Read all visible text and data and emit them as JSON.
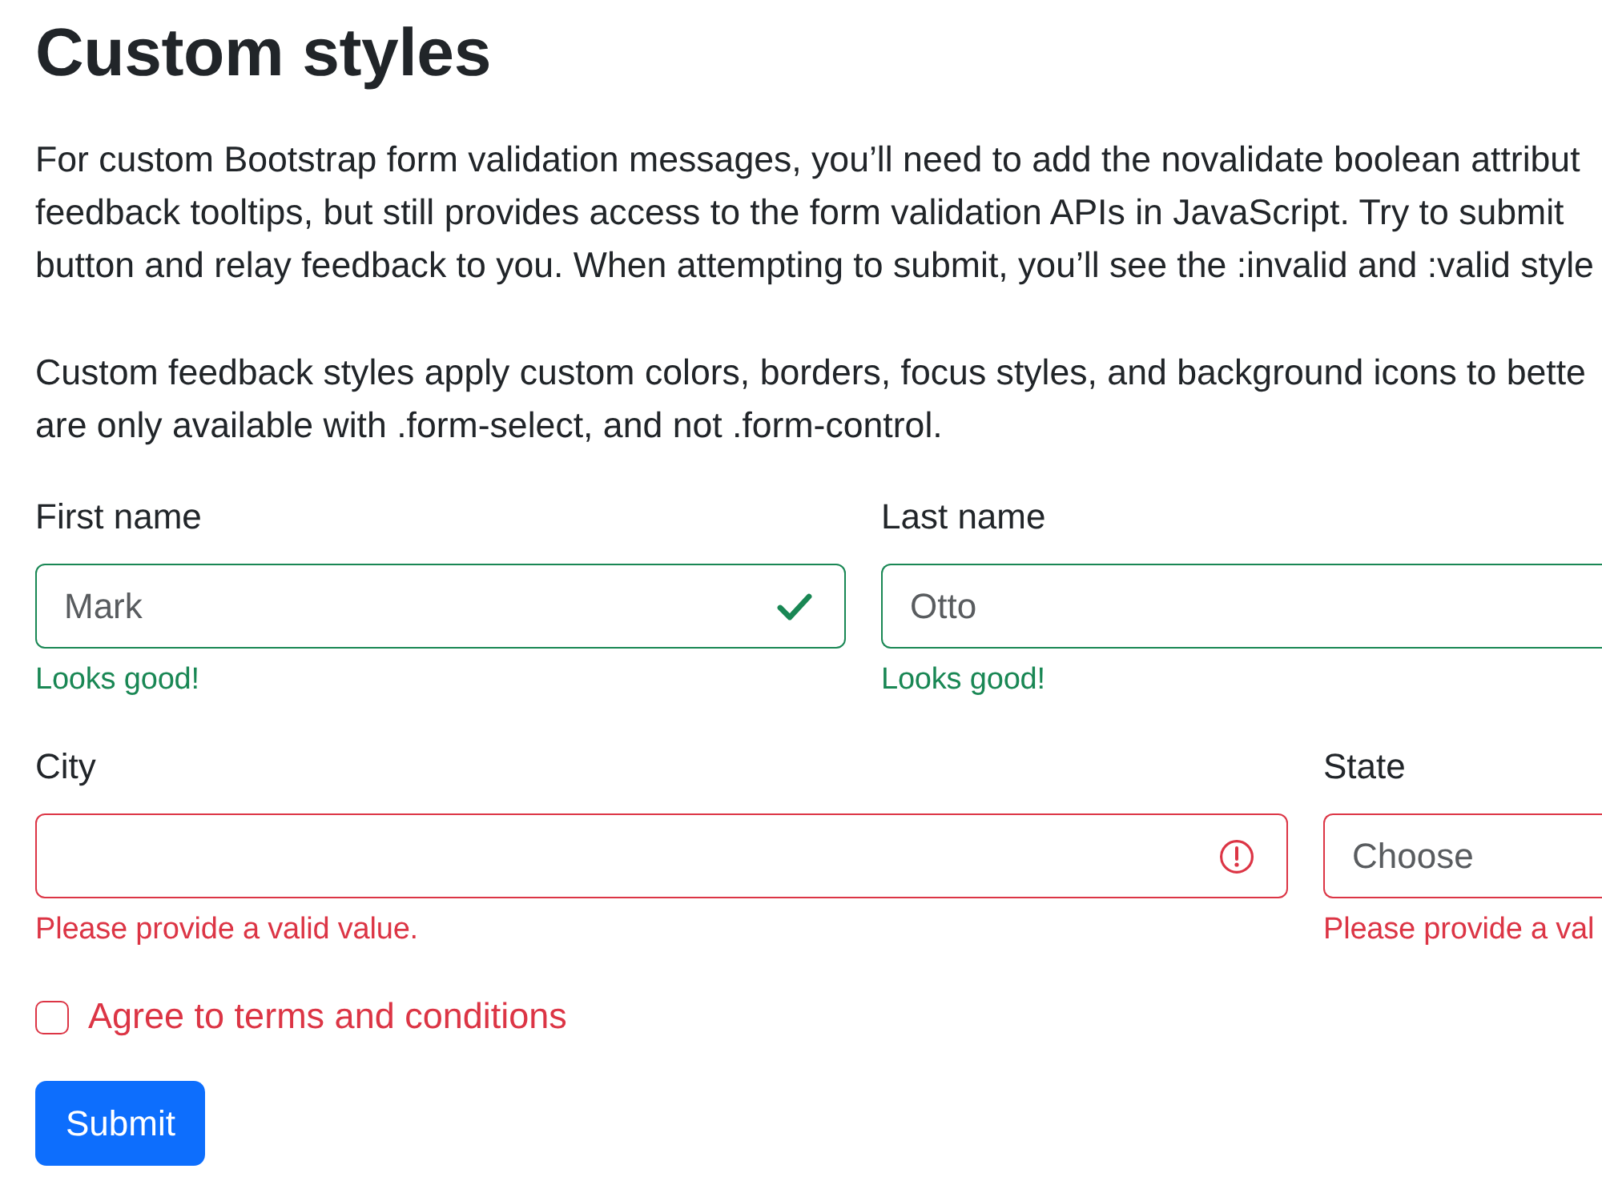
{
  "heading": "Custom styles",
  "paragraphs": [
    {
      "lines": [
        "For custom Bootstrap form validation messages, you’ll need to add the novalidate boolean attribut",
        "feedback tooltips, but still provides access to the form validation APIs in JavaScript. Try to submit",
        "button and relay feedback to you. When attempting to submit, you’ll see the :invalid and :valid style"
      ]
    },
    {
      "lines": [
        "Custom feedback styles apply custom colors, borders, focus styles, and background icons to bette",
        "are only available with .form-select, and not .form-control."
      ]
    }
  ],
  "form": {
    "rows": [
      {
        "fields": [
          {
            "label": "First name",
            "value": "Mark",
            "valid": true,
            "icon": true,
            "feedback": "Looks good!"
          },
          {
            "label": "Last name",
            "value": "Otto",
            "valid": true,
            "icon": false,
            "feedback": "Looks good!"
          }
        ]
      },
      {
        "fields": [
          {
            "label": "City",
            "valid": false,
            "icon": true,
            "feedback": "Please provide a valid value."
          },
          {
            "label": "State",
            "value": "Choose",
            "valid": false,
            "icon": false,
            "feedback": "Please provide a val"
          }
        ]
      }
    ],
    "checkbox": {
      "label": "Agree to terms and conditions",
      "checked": false,
      "valid": false
    },
    "submit": {
      "label": "Submit"
    }
  }
}
